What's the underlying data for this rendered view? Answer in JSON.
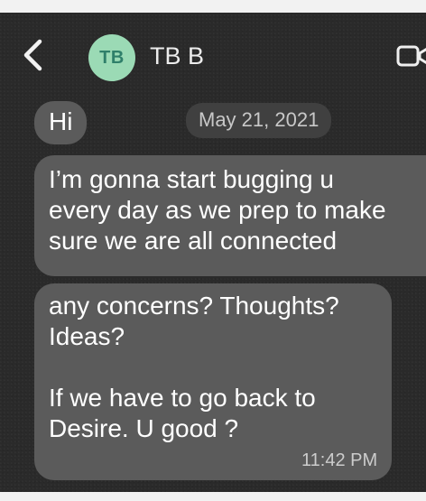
{
  "header": {
    "contact_initials": "TB",
    "contact_name": "TB B",
    "back_icon": "chevron-left-icon",
    "video_icon": "video-call-icon"
  },
  "conversation": {
    "date_label": "May 21, 2021",
    "messages": [
      {
        "lines": [
          "Hi"
        ]
      },
      {
        "lines": [
          "I’m gonna start bugging u",
          "every day as we prep to make",
          "sure we are all connected"
        ]
      },
      {
        "lines": [
          "any concerns? Thoughts?",
          "Ideas?",
          "",
          "If we have to go back to",
          "Desire. U good ?"
        ],
        "time": "11:42 PM"
      }
    ]
  },
  "colors": {
    "screen_background": "#2a2a2a",
    "bubble": "#5b5b5b",
    "avatar_background": "#9bdab5",
    "avatar_text": "#2f7f6a",
    "text": "#ffffff"
  }
}
